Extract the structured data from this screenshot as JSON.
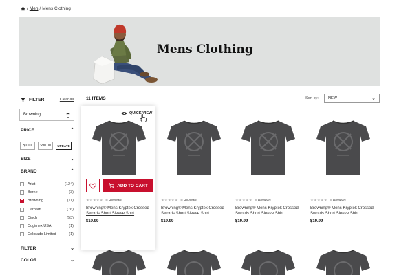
{
  "breadcrumb": {
    "home_icon": "home-icon",
    "sep1": "/",
    "link": "Men",
    "sep2": "/",
    "current": "Mens Clothing"
  },
  "hero": {
    "title": "Mens Clothing",
    "bg_color": "#dfe1e0"
  },
  "sidebar": {
    "filter_label": "FILTER",
    "clear_all": "Clear all",
    "active_chip": "Browning",
    "price": {
      "title": "PRICE",
      "min": "$0.00",
      "max": "$90.00",
      "update": "UPDATE"
    },
    "size": {
      "title": "SIZE"
    },
    "brand": {
      "title": "BRAND",
      "items": [
        {
          "name": "Ariat",
          "count": "(124)",
          "checked": false
        },
        {
          "name": "Berne",
          "count": "(3)",
          "checked": false
        },
        {
          "name": "Browning",
          "count": "(11)",
          "checked": true
        },
        {
          "name": "Carhartt",
          "count": "(76)",
          "checked": false
        },
        {
          "name": "Cinch",
          "count": "(53)",
          "checked": false
        },
        {
          "name": "Cogimex USA",
          "count": "(1)",
          "checked": false
        },
        {
          "name": "Colorado Limited",
          "count": "(1)",
          "checked": false
        }
      ]
    },
    "filter2": {
      "title": "FILTER"
    },
    "color": {
      "title": "COLOR"
    }
  },
  "main": {
    "items_count": "11 ITEMS",
    "sort_label": "Sort by:",
    "sort_value": "NEW",
    "quick_view": "QUICK VIEW",
    "add_to_cart": "ADD TO CART",
    "accent_color": "#c8102e",
    "products": [
      {
        "title": "Browning® Mens Kryptek Crossed Swords Short Sleeve Shirt",
        "reviews": "0 Reviews",
        "price": "$19.99"
      },
      {
        "title": "Browning® Mens Kryptek Crossed Swords Short Sleeve Shirt",
        "reviews": "0 Reviews",
        "price": "$19.99"
      },
      {
        "title": "Browning® Mens Kryptek Crossed Swords Short Sleeve Shirt",
        "reviews": "0 Reviews",
        "price": "$19.99"
      },
      {
        "title": "Browning® Mens Kryptek Crossed Swords Short Sleeve Shirt",
        "reviews": "0 Reviews",
        "price": "$19.99"
      }
    ]
  }
}
